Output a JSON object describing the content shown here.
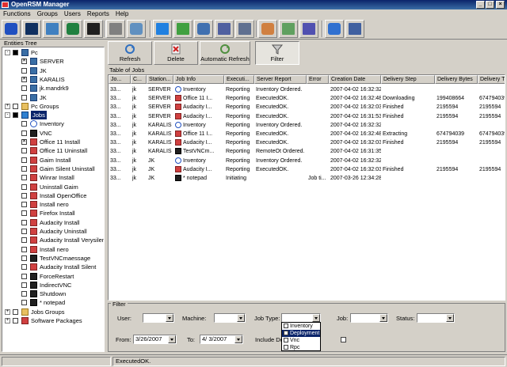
{
  "window": {
    "title": "OpenRSM Manager"
  },
  "menu": [
    "Functions",
    "Groups",
    "Users",
    "Reports",
    "Help"
  ],
  "colors": {
    "title_bar": "#0a246a",
    "selection": "#0a246a",
    "face": "#d4d0c8"
  },
  "toolbar_icons": [
    "info-icon",
    "eye-icon",
    "computer-icon",
    "monitor-icon",
    "terminal-icon",
    "gear-icon",
    "tools-icon",
    "cube-icon",
    "packages-icon",
    "network-icon",
    "deploy-icon",
    "report-icon",
    "users-icon",
    "chart-icon",
    "server-icon",
    "globe-icon",
    "pcs-icon"
  ],
  "tree": {
    "header": "Entities Tree",
    "nodes": [
      {
        "label": "Pc",
        "level": 0,
        "expand": "-",
        "check": "fill",
        "icon": "pc"
      },
      {
        "label": "SERVER",
        "level": 1,
        "expand": "",
        "check": "x",
        "icon": "pc"
      },
      {
        "label": "JK",
        "level": 1,
        "expand": "",
        "check": "",
        "icon": "pc"
      },
      {
        "label": "KARALIS",
        "level": 1,
        "expand": "",
        "check": "x",
        "icon": "pc"
      },
      {
        "label": "jk.mandrk9",
        "level": 1,
        "expand": "",
        "check": "",
        "icon": "pc"
      },
      {
        "label": "JK",
        "level": 1,
        "expand": "",
        "check": "",
        "icon": "pc"
      },
      {
        "label": "Pc Groups",
        "level": 0,
        "expand": "+",
        "check": "",
        "icon": "group"
      },
      {
        "label": "Jobs",
        "level": 0,
        "expand": "-",
        "check": "fill",
        "icon": "job",
        "selected": true
      },
      {
        "label": "Inventory",
        "level": 1,
        "expand": "",
        "check": "",
        "icon": "info"
      },
      {
        "label": "VNC",
        "level": 1,
        "expand": "",
        "check": "",
        "icon": "term"
      },
      {
        "label": "Office 11 Install",
        "level": 1,
        "expand": "",
        "check": "x",
        "icon": "pkg"
      },
      {
        "label": "Office 11 Uninstall",
        "level": 1,
        "expand": "",
        "check": "",
        "icon": "pkg"
      },
      {
        "label": "Gaim Install",
        "level": 1,
        "expand": "",
        "check": "",
        "icon": "pkg"
      },
      {
        "label": "Gaim Silent Uninstall",
        "level": 1,
        "expand": "",
        "check": "",
        "icon": "pkg"
      },
      {
        "label": "Winrar Install",
        "level": 1,
        "expand": "",
        "check": "",
        "icon": "pkg"
      },
      {
        "label": "Uninstall Gaim",
        "level": 1,
        "expand": "",
        "check": "",
        "icon": "pkg"
      },
      {
        "label": "Install OpenOffice",
        "level": 1,
        "expand": "",
        "check": "",
        "icon": "pkg"
      },
      {
        "label": "Install nero",
        "level": 1,
        "expand": "",
        "check": "",
        "icon": "pkg"
      },
      {
        "label": "Firefox Install",
        "level": 1,
        "expand": "",
        "check": "",
        "icon": "pkg"
      },
      {
        "label": "Audacity Install",
        "level": 1,
        "expand": "",
        "check": "",
        "icon": "pkg"
      },
      {
        "label": "Audacity Uninstall",
        "level": 1,
        "expand": "",
        "check": "",
        "icon": "pkg"
      },
      {
        "label": "Audacity Install Verysilent",
        "level": 1,
        "expand": "",
        "check": "",
        "icon": "pkg"
      },
      {
        "label": "Install nero",
        "level": 1,
        "expand": "",
        "check": "",
        "icon": "pkg"
      },
      {
        "label": "TestVNCmaessage",
        "level": 1,
        "expand": "",
        "check": "",
        "icon": "term"
      },
      {
        "label": "Audacity Install Silent",
        "level": 1,
        "expand": "",
        "check": "",
        "icon": "pkg"
      },
      {
        "label": "ForceRestart",
        "level": 1,
        "expand": "",
        "check": "",
        "icon": "term"
      },
      {
        "label": "IndirectVNC",
        "level": 1,
        "expand": "",
        "check": "",
        "icon": "term"
      },
      {
        "label": "Shutdown",
        "level": 1,
        "expand": "",
        "check": "",
        "icon": "term"
      },
      {
        "label": "* notepad",
        "level": 1,
        "expand": "",
        "check": "",
        "icon": "term"
      },
      {
        "label": "Jobs Groups",
        "level": 0,
        "expand": "+",
        "check": "",
        "icon": "group"
      },
      {
        "label": "Software Packages",
        "level": 0,
        "expand": "+",
        "check": "",
        "icon": "pkg"
      }
    ]
  },
  "actions": {
    "refresh": "Refresh",
    "delete": "Delete",
    "auto_refresh": "Automatic Refresh",
    "filter": "Filter"
  },
  "table": {
    "title": "Table of Jobs",
    "columns": [
      "Jo...",
      "C...",
      "Station...",
      "Job Info",
      "Executi...",
      "Server Report",
      "Error",
      "Creation Date",
      "Delivery Step",
      "Delivery Bytes",
      "Delivery Total"
    ],
    "rows": [
      [
        "33...",
        "jk",
        "SERVER",
        "Inventory",
        "Reporting",
        "Inventory Ordered.",
        "",
        "2007-04-02 16:32:32",
        "",
        "",
        ""
      ],
      [
        "33...",
        "jk",
        "SERVER",
        "Office 11 I...",
        "Reporting",
        "ExecutedOK.",
        "",
        "2007-04-02 16:32:48",
        "Downloading",
        "199408664",
        "674794039"
      ],
      [
        "33...",
        "jk",
        "SERVER",
        "Audacity I...",
        "Reporting",
        "ExecutedOK.",
        "",
        "2007-04-02 16:32:03",
        "Finished",
        "2195594",
        "2195594"
      ],
      [
        "33...",
        "jk",
        "SERVER",
        "Audacity I...",
        "Reporting",
        "ExecutedOK.",
        "",
        "2007-04-02 16:31:53",
        "Finished",
        "2195594",
        "2195594"
      ],
      [
        "33...",
        "jk",
        "KARALIS",
        "Inventory",
        "Reporting",
        "Inventory Ordered.",
        "",
        "2007-04-02 16:32:32",
        "",
        "",
        ""
      ],
      [
        "33...",
        "jk",
        "KARALIS",
        "Office 11 I...",
        "Reporting",
        "ExecutedOK.",
        "",
        "2007-04-02 16:32:48",
        "Extracting",
        "674794039",
        "674794039"
      ],
      [
        "33...",
        "jk",
        "KARALIS",
        "Audacity I...",
        "Reporting",
        "ExecutedOK.",
        "",
        "2007-04-02 16:32:03",
        "Finished",
        "2195594",
        "2195594"
      ],
      [
        "33...",
        "jk",
        "KARALIS",
        "TestVNCm...",
        "Reporting",
        "RemoteOt Ordered.",
        "",
        "2007-04-02 16:31:35",
        "",
        "",
        ""
      ],
      [
        "33...",
        "jk",
        "JK",
        "Inventory",
        "Reporting",
        "Inventory Ordered.",
        "",
        "2007-04-02 16:32:32",
        "",
        "",
        ""
      ],
      [
        "33...",
        "jk",
        "JK",
        "Audacity I...",
        "Reporting",
        "ExecutedOK.",
        "",
        "2007-04-02 16:32:03",
        "Finished",
        "2195594",
        "2195594"
      ],
      [
        "33...",
        "jk",
        "JK",
        "* notepad",
        "Initiating",
        "",
        "Job ti...",
        "2007-03-26 12:34:28",
        "",
        "",
        ""
      ]
    ],
    "row_icons": [
      "info",
      "pkg",
      "pkg",
      "pkg",
      "info",
      "pkg",
      "pkg",
      "term",
      "info",
      "pkg",
      "term"
    ]
  },
  "filter": {
    "title": "Filter",
    "user_label": "User:",
    "machine_label": "Machine:",
    "job_type_label": "Job Type:",
    "job_label": "Job:",
    "status_label": "Status:",
    "from_label": "From:",
    "from_value": "3/26/2007",
    "to_label": "To:",
    "to_value": "4/ 3/2007",
    "include_label": "Include De",
    "job_type_options": [
      "Inventory",
      "Deployment",
      "Vnc",
      "Rpc"
    ],
    "job_type_selected": "Deployment"
  },
  "status": {
    "message": "ExecutedOK."
  }
}
